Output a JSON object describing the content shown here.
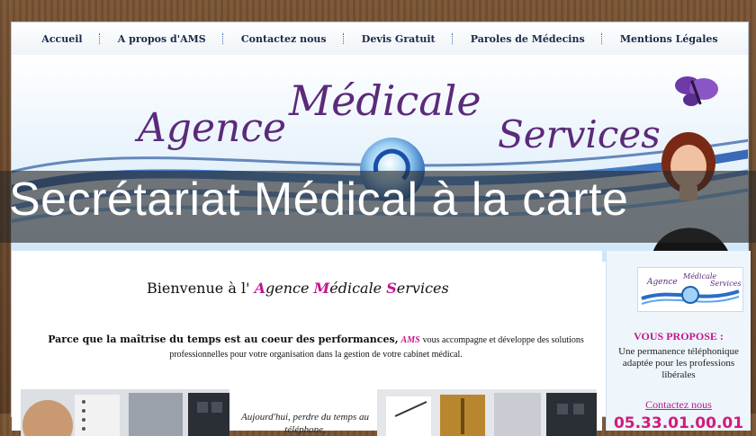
{
  "nav": {
    "items": [
      {
        "label": "Accueil"
      },
      {
        "label": "A propos d'AMS"
      },
      {
        "label": "Contactez nous"
      },
      {
        "label": "Devis Gratuit"
      },
      {
        "label": "Paroles de Médecins"
      },
      {
        "label": "Mentions Légales"
      }
    ]
  },
  "banner": {
    "logo_word1": "Agence",
    "logo_word2": "Médicale",
    "logo_word3": "Services"
  },
  "overlay": {
    "title": "Secrétariat Médical à la carte"
  },
  "main": {
    "welcome_prefix": "Bienvenue à l'",
    "welcome_A": "A",
    "welcome_gence": "gence ",
    "welcome_M": "M",
    "welcome_edicale": "édicale ",
    "welcome_S": "S",
    "welcome_ervices": "ervices",
    "intro_strong": "Parce que la maîtrise du temps est au coeur des performances",
    "intro_comma": ",",
    "intro_ams": "AMS",
    "intro_rest": "vous accompagne et développe des solutions professionnelles pour votre organisation dans la gestion de votre cabinet médical.",
    "quote_line1": "Aujourd'hui, perdre du temps au",
    "quote_line2": "téléphone,"
  },
  "sidebar": {
    "heading": "VOUS PROPOSE :",
    "text": "Une permanence téléphonique adaptée pour les professions libérales",
    "contact_link": "Contactez nous",
    "phone": "05.33.01.00.01"
  },
  "colors": {
    "accent_magenta": "#c0178c",
    "nav_text": "#1b2a4a",
    "overlay_bg": "rgba(40,40,40,0.62)"
  }
}
